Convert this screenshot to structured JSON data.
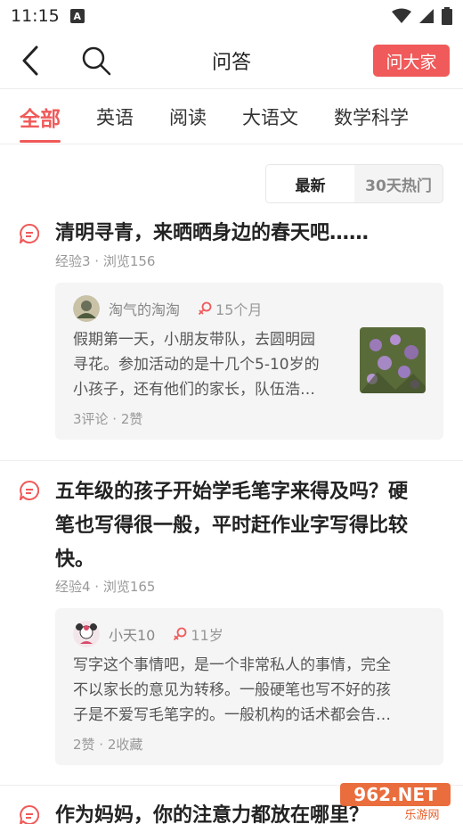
{
  "status_bar": {
    "time": "11:15",
    "a_glyph": "A"
  },
  "header": {
    "title": "问答",
    "ask_button": "问大家"
  },
  "tabs": [
    {
      "label": "全部",
      "active": true
    },
    {
      "label": "英语",
      "active": false
    },
    {
      "label": "阅读",
      "active": false
    },
    {
      "label": "大语文",
      "active": false
    },
    {
      "label": "数学科学",
      "active": false
    }
  ],
  "sort": {
    "latest": "最新",
    "hot": "30天热门"
  },
  "questions": [
    {
      "title": "清明寻青，来晒晒身边的春天吧……",
      "meta": "经验3 · 浏览156",
      "answer": {
        "user": "淘气的淘淘",
        "badge": "15个月",
        "text_lines": [
          "假期第一天，小朋友带队，去圆明园",
          "寻花。参加活动的是十几个5-10岁的",
          "小孩子，还有他们的家长，队伍浩…"
        ],
        "stats": "3评论 · 2赞"
      }
    },
    {
      "title_lines": [
        "五年级的孩子开始学毛笔字来得及吗？硬",
        "笔也写得很一般，平时赶作业字写得比较",
        "快。"
      ],
      "meta": "经验4 · 浏览165",
      "answer": {
        "user": "小天10",
        "badge": "11岁",
        "text_lines": [
          "写字这个事情吧，是一个非常私人的事情，完全",
          "不以家长的意见为转移。一般硬笔也写不好的孩",
          "子是不爱写毛笔字的。一般机构的话术都会告…"
        ],
        "stats": "2赞 · 2收藏"
      }
    },
    {
      "title": "作为妈妈，你的注意力都放在哪里？"
    }
  ],
  "watermark": {
    "text": "962.NET",
    "sub": "乐游网"
  },
  "colors": {
    "accent": "#f05a5a"
  }
}
